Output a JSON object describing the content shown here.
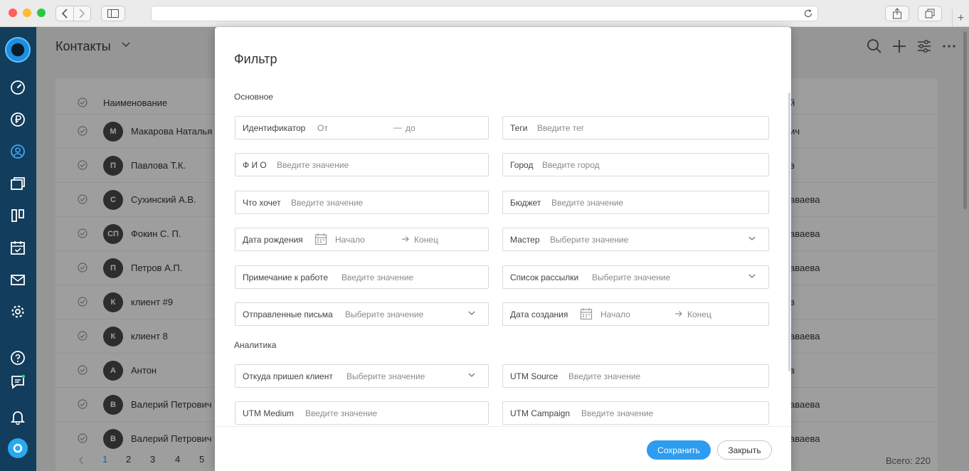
{
  "app": {
    "title": "Контакты",
    "columns": {
      "name": "Наименование"
    },
    "rows": [
      {
        "initials": "М",
        "name": "Макарова Наталья",
        "right": "ич"
      },
      {
        "initials": "П",
        "name": "Павлова Т.К.",
        "right": "в"
      },
      {
        "initials": "С",
        "name": "Сухинский А.В.",
        "right": "аваева"
      },
      {
        "initials": "СП",
        "name": "Фокин С. П.",
        "right": "аваева"
      },
      {
        "initials": "П",
        "name": "Петров А.П.",
        "right": "аваева"
      },
      {
        "initials": "К",
        "name": "клиент #9",
        "right": "в"
      },
      {
        "initials": "К",
        "name": "клиент 8",
        "right": "аваева"
      },
      {
        "initials": "А",
        "name": "Антон",
        "right": "в"
      },
      {
        "initials": "В",
        "name": "Валерий Петрович",
        "right": "аваева"
      },
      {
        "initials": "В",
        "name": "Валерий Петрович",
        "right": "аваева"
      }
    ],
    "pager": {
      "pages": [
        "1",
        "2",
        "3",
        "4",
        "5"
      ]
    },
    "total": "Всего: 220"
  },
  "modal": {
    "title": "Фильтр",
    "sections": {
      "main": "Основное",
      "analytics": "Аналитика"
    },
    "fields": {
      "identifier": {
        "label": "Идентификатор",
        "from": "От",
        "dash": "—",
        "to": "до"
      },
      "tags": {
        "label": "Теги",
        "placeholder": "Введите тег"
      },
      "fio": {
        "label": "Ф И О",
        "placeholder": "Введите значение"
      },
      "city": {
        "label": "Город",
        "placeholder": "Введите город"
      },
      "wants": {
        "label": "Что хочет",
        "placeholder": "Введите значение"
      },
      "budget": {
        "label": "Бюджет",
        "placeholder": "Введите значение"
      },
      "birthdate": {
        "label": "Дата рождения",
        "start": "Начало",
        "end": "Конец"
      },
      "master": {
        "label": "Мастер",
        "placeholder": "Выберите значение"
      },
      "work_note": {
        "label": "Примечание к работе",
        "placeholder": "Введите значение"
      },
      "mailing_list": {
        "label": "Список рассылки",
        "placeholder": "Выберите значение"
      },
      "sent_letters": {
        "label": "Отправленные письма",
        "placeholder": "Выберите значение"
      },
      "created_date": {
        "label": "Дата создания",
        "start": "Начало",
        "end": "Конец"
      },
      "source": {
        "label": "Откуда пришел клиент",
        "placeholder": "Выберите значение"
      },
      "utm_source": {
        "label": "UTM Source",
        "placeholder": "Введите значение"
      },
      "utm_medium": {
        "label": "UTM Medium",
        "placeholder": "Введите значение"
      },
      "utm_campaign": {
        "label": "UTM Campaign",
        "placeholder": "Введите значение"
      }
    },
    "buttons": {
      "save": "Сохранить",
      "close": "Закрыть"
    }
  },
  "colors": {
    "accent": "#2e9cf0",
    "sidebar": "#133d5c"
  }
}
